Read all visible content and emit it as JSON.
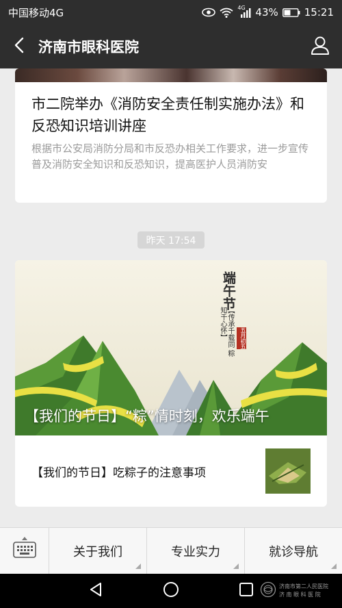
{
  "status_bar": {
    "carrier": "中国移动4G",
    "network_badge": "4G",
    "battery_percent": "43%",
    "time": "15:21"
  },
  "header": {
    "title": "济南市眼科医院"
  },
  "articles": [
    {
      "title": "市二院举办《消防安全责任制实施办法》和反恐知识培训讲座",
      "description": "根据市公安局消防分局和市反恐办相关工作要求，进一步宣传普及消防安全知识和反恐知识，提高医护人员消防安"
    }
  ],
  "timestamp": "昨天 17:54",
  "news_group": {
    "cover_title": "【我们的节日】“粽”情时刻，欢乐端午",
    "cover_art": {
      "title": "端午节",
      "seal": "五月初五",
      "verse": "【传承千载同 粽知千心怀】"
    },
    "sub_items": [
      {
        "title": "【我们的节日】吃粽子的注意事项"
      }
    ]
  },
  "bottom_menu": {
    "items": [
      "关于我们",
      "专业实力",
      "就诊导航"
    ]
  },
  "watermark": {
    "line1": "济南市第二人民医院",
    "line2": "济 南 眼 科 医 院"
  },
  "colors": {
    "header_bg": "#2e2e2e",
    "page_bg": "#ececec"
  },
  "icons": [
    "eye-icon",
    "wifi-icon",
    "signal-icon",
    "battery-icon",
    "back-icon",
    "profile-icon",
    "keyboard-icon",
    "nav-back-icon",
    "nav-home-icon",
    "nav-recents-icon"
  ]
}
